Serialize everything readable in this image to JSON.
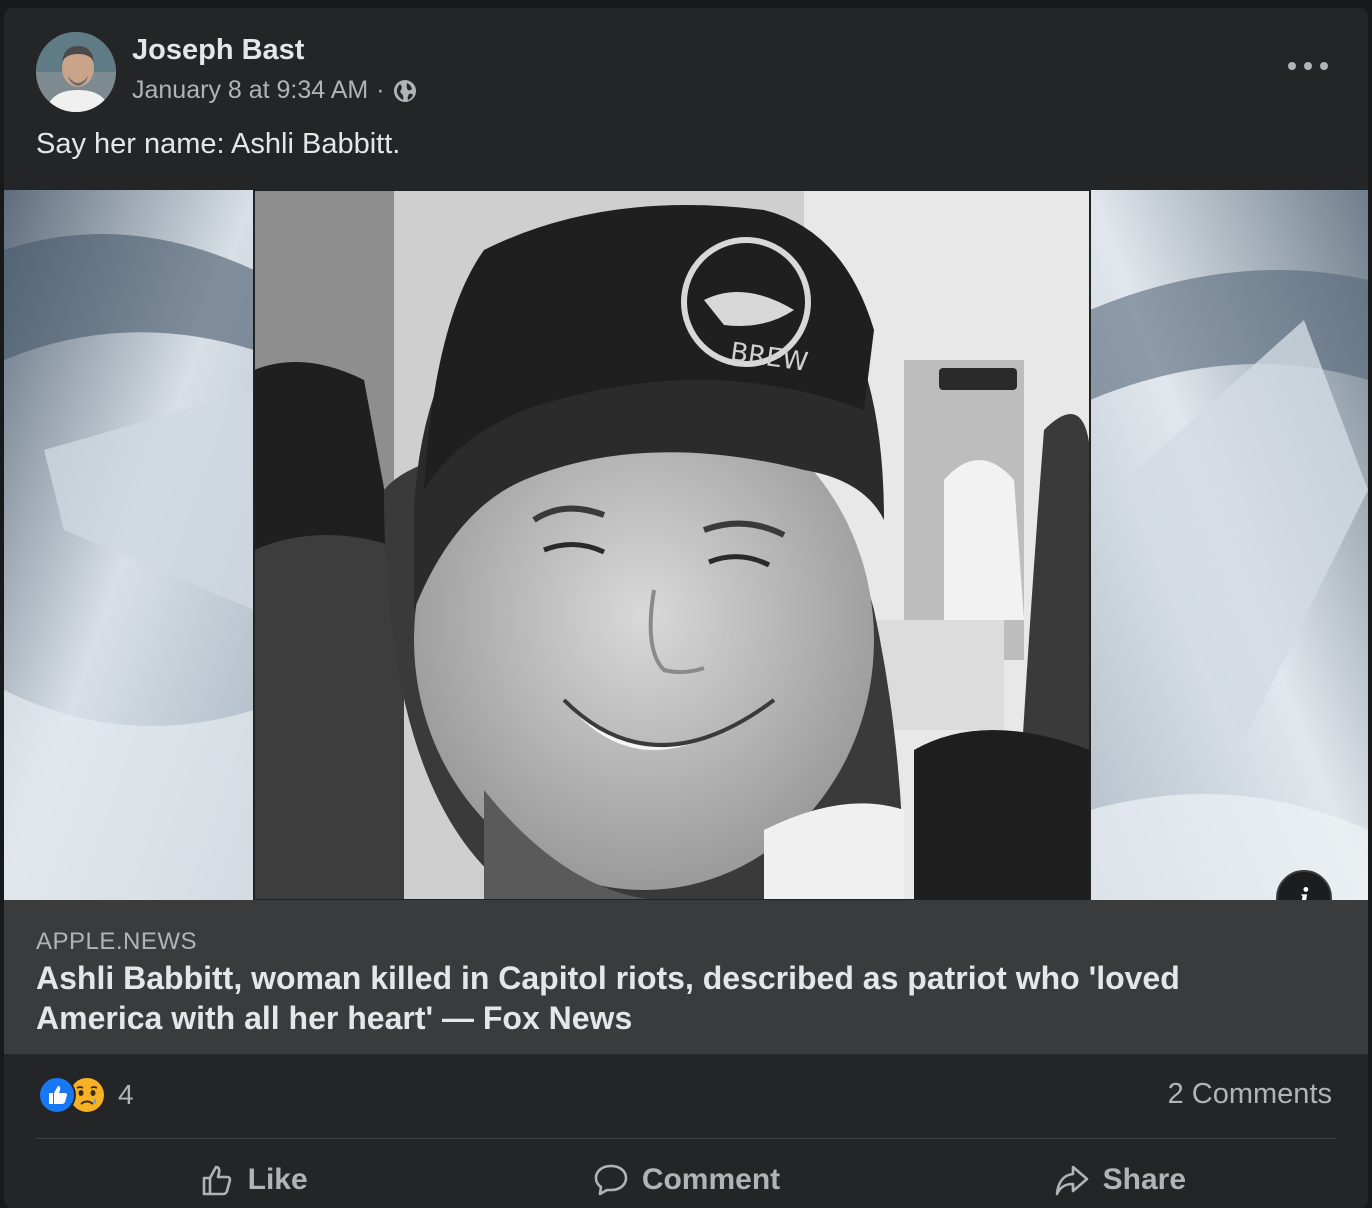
{
  "post": {
    "author": "Joseph Bast",
    "timestamp": "January 8 at 9:34 AM",
    "separator": "·",
    "privacy_icon": "globe-icon",
    "text": "Say her name: Ashli Babbitt.",
    "more_icon": "more-horizontal-icon"
  },
  "link_preview": {
    "domain": "APPLE.NEWS",
    "title": "Ashli Babbitt, woman killed in Capitol riots, described as patriot who 'loved America with all her heart' — Fox News",
    "info_label": "i"
  },
  "engagement": {
    "reaction_icons": [
      "like-reaction-icon",
      "sad-reaction-icon"
    ],
    "reaction_count": "4",
    "comments": "2 Comments"
  },
  "actions": {
    "like": "Like",
    "comment": "Comment",
    "share": "Share"
  },
  "colors": {
    "card_bg": "#242526",
    "page_bg": "#18191a",
    "preview_bg": "#3a3b3c",
    "like_blue": "#1877f2",
    "sad_yellow": "#f7b125"
  }
}
